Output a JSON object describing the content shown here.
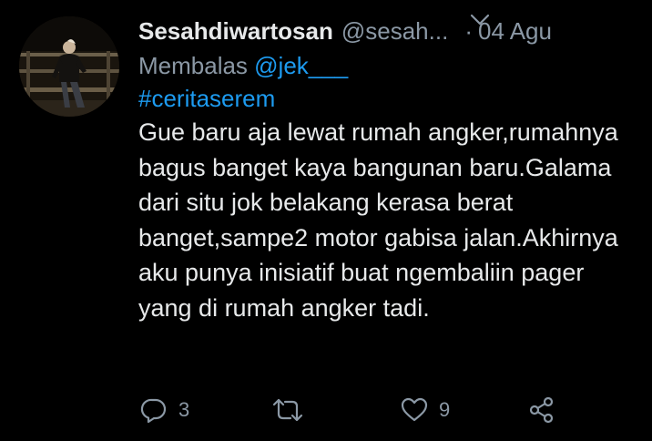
{
  "tweet": {
    "display_name": "Sesahdiwartosan",
    "handle": "@sesah...",
    "separator": "·",
    "date": "04 Agu",
    "reply_prefix": "Membalas ",
    "reply_to": "@jek___",
    "hashtag": "#ceritaserem",
    "body": "Gue baru aja lewat rumah angker,rumahnya bagus banget kaya bangunan baru.Galama dari situ jok belakang kerasa berat banget,sampe2 motor gabisa jalan.Akhirnya aku punya inisiatif buat ngembaliin pager yang di rumah angker tadi."
  },
  "actions": {
    "reply_count": "3",
    "retweet_count": "",
    "like_count": "9"
  },
  "icons": {
    "more": "chevron-down-icon",
    "reply": "reply-icon",
    "retweet": "retweet-icon",
    "like": "heart-icon",
    "share": "share-icon"
  },
  "colors": {
    "background": "#000000",
    "primary_text": "#e7e9ea",
    "secondary_text": "#8b98a5",
    "accent": "#1d9bf0"
  }
}
